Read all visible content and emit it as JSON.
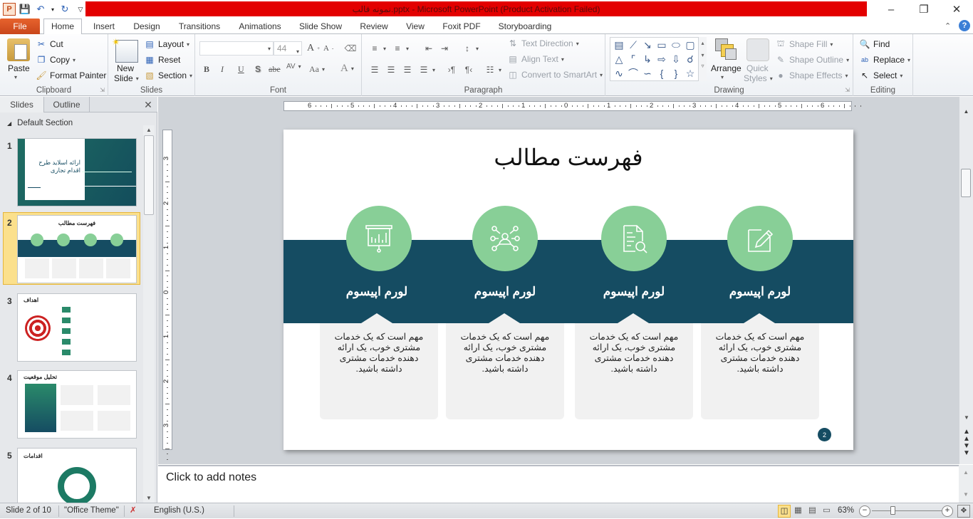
{
  "window": {
    "title": "نمونه قالب.pptx - Microsoft PowerPoint (Product Activation Failed)",
    "controls": {
      "minimize": "–",
      "restore": "❐",
      "close": "✕"
    }
  },
  "quick_access": {
    "app_icon": "P",
    "save": "save-icon",
    "undo": "undo-icon",
    "redo": "redo-icon",
    "customize": "customize-icon"
  },
  "tabs": [
    "File",
    "Home",
    "Insert",
    "Design",
    "Transitions",
    "Animations",
    "Slide Show",
    "Review",
    "View",
    "Foxit PDF",
    "Storyboarding"
  ],
  "active_tab": "Home",
  "ribbon": {
    "clipboard": {
      "label": "Clipboard",
      "paste": "Paste",
      "cut": "Cut",
      "copy": "Copy",
      "format_painter": "Format Painter"
    },
    "slides": {
      "label": "Slides",
      "new_slide_1": "New",
      "new_slide_2": "Slide",
      "layout": "Layout",
      "reset": "Reset",
      "section": "Section"
    },
    "font": {
      "label": "Font",
      "font_name": "",
      "font_size": "44",
      "bold": "B",
      "italic": "I",
      "underline": "U",
      "shadow": "S",
      "strike": "abe",
      "spacing": "AV",
      "case": "Aa",
      "color": "A"
    },
    "paragraph": {
      "label": "Paragraph",
      "text_direction": "Text Direction",
      "align_text": "Align Text",
      "smartart": "Convert to SmartArt"
    },
    "drawing": {
      "label": "Drawing",
      "arrange": "Arrange",
      "quick_styles_1": "Quick",
      "quick_styles_2": "Styles",
      "shape_fill": "Shape Fill",
      "shape_outline": "Shape Outline",
      "shape_effects": "Shape Effects"
    },
    "editing": {
      "label": "Editing",
      "find": "Find",
      "replace": "Replace",
      "select": "Select"
    }
  },
  "left_pane": {
    "tabs": [
      "Slides",
      "Outline"
    ],
    "active_tab": "Slides",
    "section": "Default Section",
    "thumbnails": [
      {
        "num": "1",
        "title": "ارائه اسلاید طرح اقدام تجاری"
      },
      {
        "num": "2",
        "title": "فهرست مطالب",
        "selected": true
      },
      {
        "num": "3",
        "title": "اهداف"
      },
      {
        "num": "4",
        "title": "تحلیل موقعیت"
      },
      {
        "num": "5",
        "title": "اقدامات"
      }
    ]
  },
  "ruler": {
    "h_ticks": [
      "6",
      "5",
      "4",
      "3",
      "2",
      "1",
      "0",
      "1",
      "2",
      "3",
      "4",
      "5",
      "6"
    ],
    "v_ticks": [
      "3",
      "2",
      "1",
      "0",
      "1",
      "2",
      "3"
    ]
  },
  "slide": {
    "title": "فهرست مطالب",
    "page_number": "2",
    "colors": {
      "band": "#154c62",
      "circle": "#88cf97",
      "card": "#f1f1f1"
    },
    "cards": [
      {
        "icon": "presentation-chart-icon",
        "title": "لورم اپیسوم",
        "text": "مهم است که یک خدمات مشتری خوب، یک ارائه دهنده خدمات مشتری داشته باشید."
      },
      {
        "icon": "network-people-icon",
        "title": "لورم اپیسوم",
        "text": "مهم است که یک خدمات مشتری خوب، یک ارائه دهنده خدمات مشتری داشته باشید."
      },
      {
        "icon": "document-search-icon",
        "title": "لورم اپیسوم",
        "text": "مهم است که یک خدمات مشتری خوب، یک ارائه دهنده خدمات مشتری داشته باشید."
      },
      {
        "icon": "edit-note-icon",
        "title": "لورم اپیسوم",
        "text": "مهم است که یک خدمات مشتری خوب، یک ارائه دهنده خدمات مشتری داشته باشید."
      }
    ]
  },
  "notes": {
    "placeholder": "Click to add notes"
  },
  "status": {
    "slide": "Slide 2 of 10",
    "theme": "\"Office Theme\"",
    "language": "English (U.S.)",
    "zoom": "63%",
    "zoom_level_percent": 63
  }
}
